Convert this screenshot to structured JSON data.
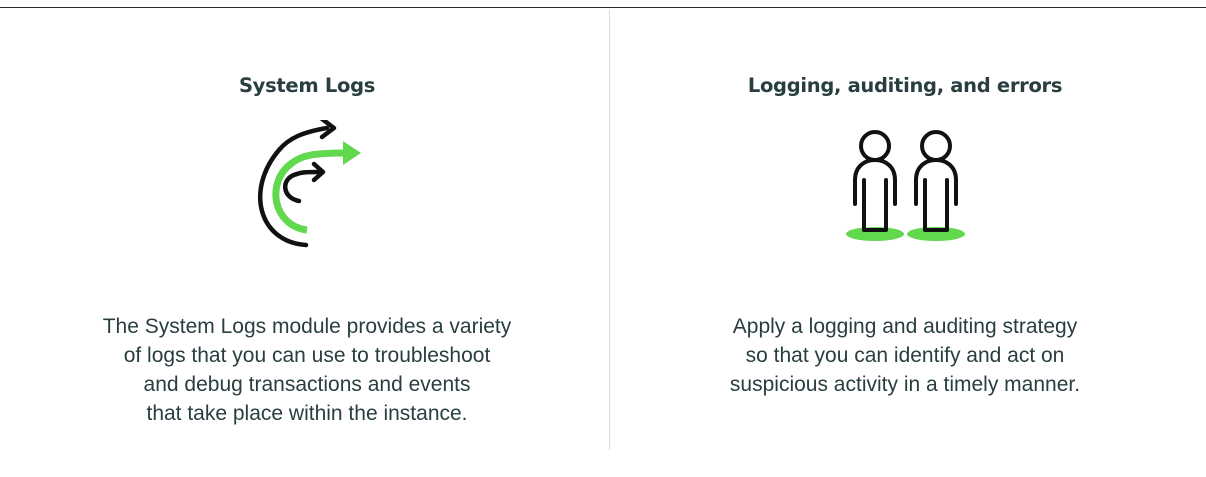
{
  "colors": {
    "title": "#293e40",
    "body_text": "#293e40",
    "accent_green": "#62d84e",
    "icon_dark": "#111111",
    "rule": "#2b2b2b",
    "divider": "#d9d9d9"
  },
  "cards": [
    {
      "title": "System Logs",
      "icon": "redirect-arrows-icon",
      "body_lines": [
        "The System Logs module provides a variety",
        "of logs that you can use to troubleshoot",
        "and debug transactions and events",
        "that take place within the instance."
      ]
    },
    {
      "title": "Logging, auditing, and errors",
      "icon": "two-people-icon",
      "body_lines": [
        "Apply a logging and auditing strategy",
        "so that you can identify and act on",
        "suspicious activity in a timely manner."
      ]
    }
  ]
}
